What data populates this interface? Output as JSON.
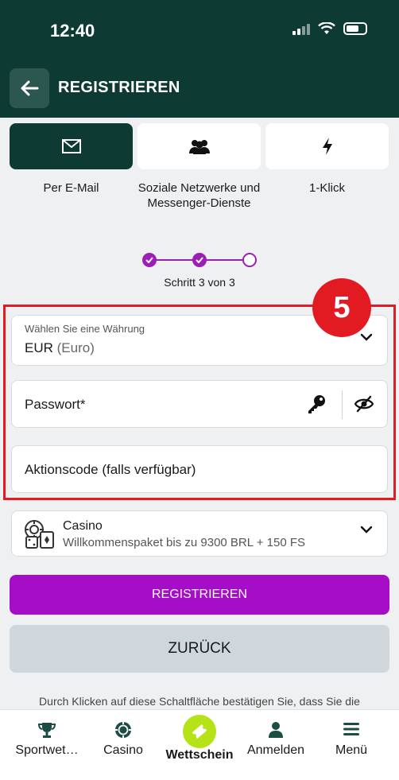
{
  "status": {
    "time": "12:40"
  },
  "header": {
    "title": "REGISTRIEREN"
  },
  "methods": [
    {
      "label": "Per E-Mail",
      "icon": "envelope-icon",
      "active": true
    },
    {
      "label": "Soziale Netzwerke und Messenger-Dienste",
      "icon": "users-icon",
      "active": false
    },
    {
      "label": "1-Klick",
      "icon": "lightning-icon",
      "active": false
    }
  ],
  "stepper": {
    "text": "Schritt 3 von 3",
    "current": 3,
    "total": 3
  },
  "callout": {
    "number": "5",
    "color": "#e21b22"
  },
  "form": {
    "currency_label": "Wählen Sie eine Währung",
    "currency_code": "EUR",
    "currency_name": "(Euro)",
    "password_placeholder": "Passwort*",
    "promo_placeholder": "Aktionscode (falls verfügbar)"
  },
  "bonus": {
    "title": "Casino",
    "subtitle": "Willkommenspaket bis zu 9300 BRL + 150 FS"
  },
  "buttons": {
    "register": "REGISTRIEREN",
    "back": "ZURÜCK"
  },
  "disclaimer": "Durch Klicken auf diese Schaltfläche bestätigen Sie, dass Sie die",
  "nav": [
    {
      "label": "Sportwet…",
      "icon": "trophy-icon"
    },
    {
      "label": "Casino",
      "icon": "casino-chip-icon"
    },
    {
      "label": "Wettschein",
      "icon": "ticket-icon",
      "active": true
    },
    {
      "label": "Anmelden",
      "icon": "user-icon"
    },
    {
      "label": "Menü",
      "icon": "menu-icon"
    }
  ],
  "colors": {
    "brand_dark": "#0d3b33",
    "accent": "#a50dc7",
    "nav_active": "#b6e317"
  }
}
